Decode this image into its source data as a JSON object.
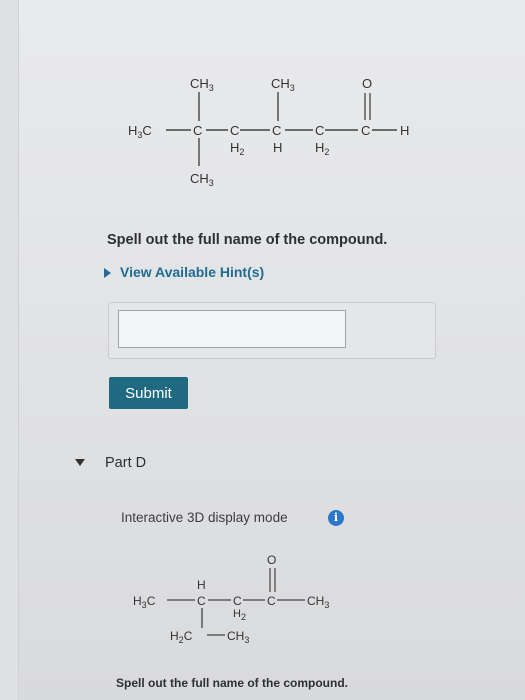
{
  "molecule_a": {
    "h3c_left": "H",
    "h3c_sub": "3",
    "h3c_c": "C",
    "c": "C",
    "ch": "C",
    "ch3_h": "H",
    "ch3_sub": "3",
    "h": "H",
    "h2": "H",
    "h2_sub": "2",
    "o": "O"
  },
  "question": {
    "prompt": "Spell out the full name of the compound.",
    "hint_label": "View Available Hint(s)",
    "answer_value": "",
    "submit_label": "Submit"
  },
  "part_d": {
    "label": "Part D",
    "mode_label": "Interactive 3D display mode",
    "info_glyph": "i",
    "prompt": "Spell out the full name of the compound."
  }
}
